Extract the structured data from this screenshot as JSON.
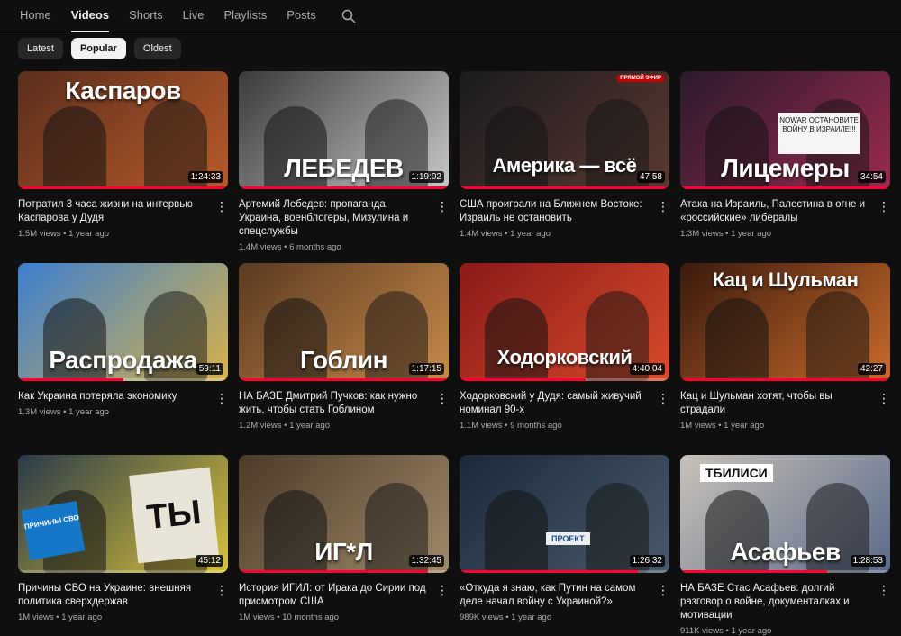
{
  "tabs": [
    "Home",
    "Videos",
    "Shorts",
    "Live",
    "Playlists",
    "Posts"
  ],
  "active_tab": "Videos",
  "search_icon": "search-icon",
  "chips": [
    "Latest",
    "Popular",
    "Oldest"
  ],
  "selected_chip": "Popular",
  "videos": [
    {
      "thumb_text": "Каспаров",
      "duration": "1:24:33",
      "watched": 1.0,
      "title": "Потратил 3 часа жизни на интервью Каспарова у Дудя",
      "views": "1.5M views",
      "age": "1 year ago",
      "bg": [
        "#5a2e1e",
        "#b85a2a"
      ]
    },
    {
      "thumb_text": "ЛЕБЕДЕВ",
      "duration": "1:19:02",
      "watched": 1.0,
      "title": "Артемий Лебедев: пропаганда, Украина, военблогеры, Мизулина и спецслужбы",
      "views": "1.4M views",
      "age": "6 months ago",
      "bg": [
        "#3a3a3a",
        "#c8c8c8"
      ]
    },
    {
      "thumb_text": "Америка — всё",
      "duration": "47:58",
      "watched": 1.0,
      "live_badge": "ПРЯМОЙ ЭФИР",
      "title": "США проиграли на Ближнем Востоке: Израиль не остановить",
      "views": "1.4M views",
      "age": "1 year ago",
      "bg": [
        "#1a1a1e",
        "#5a3a30"
      ]
    },
    {
      "thumb_text": "Лицемеры",
      "duration": "34:54",
      "watched": 1.0,
      "sign_text": "NOWAR ОСТАНОВИТЕ ВОЙНУ В ИЗРАИЛЕ!!!",
      "title": "Атака на Израиль, Палестина в огне и «российские» либералы",
      "views": "1.3M views",
      "age": "1 year ago",
      "bg": [
        "#2a1a2e",
        "#9a2a4e"
      ]
    },
    {
      "thumb_text": "Распродажа",
      "duration": "59:11",
      "watched": 0.5,
      "title": "Как Украина потеряла экономику",
      "views": "1.3M views",
      "age": "1 year ago",
      "bg": [
        "#3c7fd0",
        "#d8b24a"
      ]
    },
    {
      "thumb_text": "Гоблин",
      "duration": "1:17:15",
      "watched": 1.0,
      "title": "НА БАЗЕ Дмитрий Пучков: как нужно жить, чтобы стать Гоблином",
      "views": "1.2M views",
      "age": "1 year ago",
      "bg": [
        "#5a3a22",
        "#c88a4a"
      ]
    },
    {
      "thumb_text": "Ходорковский",
      "duration": "4:40:04",
      "watched": 0.6,
      "title": "Ходорковский у Дудя: самый живучий номинал 90-х",
      "views": "1.1M views",
      "age": "9 months ago",
      "bg": [
        "#8a1a1a",
        "#d84a2a"
      ]
    },
    {
      "thumb_text": "Кац и Шульман",
      "duration": "42:27",
      "watched": 1.0,
      "title": "Кац и Шульман хотят, чтобы вы страдали",
      "views": "1M views",
      "age": "1 year ago",
      "bg": [
        "#3a1a0e",
        "#c86a2a"
      ]
    },
    {
      "thumb_text": "ТЫ",
      "duration": "45:12",
      "watched": 0.0,
      "book_text": "ПРИЧИНЫ СВО",
      "title": "Причины СВО на Украине: внешняя политика сверхдержав",
      "views": "1M views",
      "age": "1 year ago",
      "bg": [
        "#2a3a4a",
        "#d8c23a"
      ]
    },
    {
      "thumb_text": "ИГ*Л",
      "duration": "1:32:45",
      "watched": 0.9,
      "title": "История ИГИЛ: от Ирака до Сирии под присмотром США",
      "views": "1M views",
      "age": "10 months ago",
      "bg": [
        "#4a3a2a",
        "#a08a6a"
      ]
    },
    {
      "thumb_text": "",
      "duration": "1:26:32",
      "watched": 0.85,
      "sticker_text": "ПРОЕКТ",
      "title": "«Откуда я знаю, как Путин на самом деле начал войну с Украиной?»",
      "views": "989K views",
      "age": "1 year ago",
      "bg": [
        "#1a2a3a",
        "#4a5a6a"
      ]
    },
    {
      "thumb_text": "Асафьев",
      "duration": "1:28:53",
      "watched": 0.7,
      "tag_text": "ТБИЛИСИ",
      "title": "НА БАЗЕ Стас Асафьев: долгий разговор о войне, документалках и мотивации",
      "views": "911K views",
      "age": "1 year ago",
      "bg": [
        "#c8c2b8",
        "#5a6a8a"
      ]
    }
  ]
}
